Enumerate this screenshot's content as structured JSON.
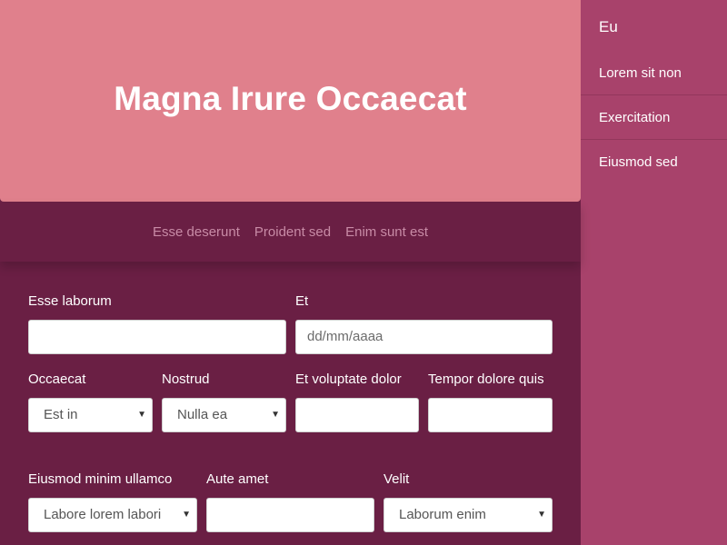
{
  "hero": {
    "title": "Magna Irure Occaecat"
  },
  "subnav": {
    "links": [
      "Esse deserunt",
      "Proident sed",
      "Enim sunt est"
    ]
  },
  "form": {
    "esse_laborum": {
      "label": "Esse laborum",
      "value": ""
    },
    "et": {
      "label": "Et",
      "placeholder": "dd/mm/aaaa"
    },
    "occaecat": {
      "label": "Occaecat",
      "selected": "Est in"
    },
    "nostrud": {
      "label": "Nostrud",
      "selected": "Nulla ea"
    },
    "et_voluptate_dolor": {
      "label": "Et voluptate dolor",
      "value": ""
    },
    "tempor_dolore_quis": {
      "label": "Tempor dolore quis",
      "value": ""
    },
    "eiusmod_minim_ullamco": {
      "label": "Eiusmod minim ullamco",
      "selected": "Labore lorem labori"
    },
    "aute_amet": {
      "label": "Aute amet",
      "value": ""
    },
    "velit": {
      "label": "Velit",
      "selected": "Laborum enim"
    }
  },
  "sidebar": {
    "brand": "Eu",
    "items": [
      "Lorem sit non",
      "Exercitation",
      "Eiusmod sed"
    ]
  },
  "colors": {
    "background": "#6a1f44",
    "hero": "#e0808c",
    "sidebar": "#a8426b",
    "subnav_link": "#c88ba6"
  }
}
